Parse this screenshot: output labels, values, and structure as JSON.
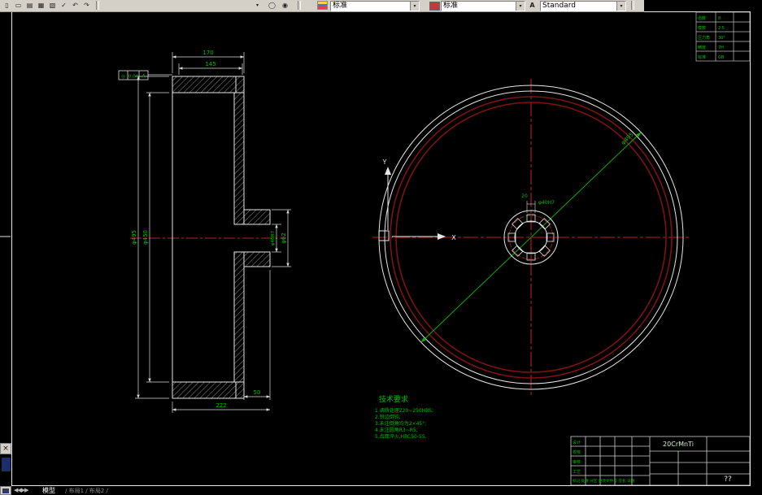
{
  "toolbar": {
    "menu_arrow": "▾",
    "icons": {
      "new": "▯",
      "open": "▭",
      "save": "▤",
      "print": "▦",
      "preview": "▧",
      "spell": "✓",
      "undo": "↶",
      "redo": "↷",
      "orbit1": "◯",
      "orbit2": "◉",
      "text_style": "A"
    },
    "combos": [
      {
        "name": "layer",
        "value": "标准"
      },
      {
        "name": "dimstyle",
        "value": "标准"
      },
      {
        "name": "textstyle",
        "value": "Standard"
      }
    ]
  },
  "drawing": {
    "ucs": {
      "x": "X",
      "y": "Y"
    },
    "left_view": {
      "dims": {
        "top": "170",
        "top2": "145",
        "od": "φ495",
        "id": "φ450",
        "hub_od": "φ62",
        "bore": "φ40H7",
        "hub_len": "50",
        "total_len": "222"
      },
      "gdt": {
        "sym": "◎",
        "tol": "0.04",
        "datum": "A"
      }
    },
    "front_view": {
      "dims": {
        "diameter": "φ495",
        "spline_w": "20",
        "spline_bore": "φ40H7"
      }
    },
    "tech_req": {
      "title": "技术要求",
      "lines": [
        "1.调质处理220~250HBS;",
        "2.锐边倒钝;",
        "3.未注倒角均为2×45°;",
        "4.未注圆角R3~R5;",
        "5.齿面淬火,HRC50-55."
      ]
    },
    "param_table": {
      "rows": [
        {
          "label": "齿数",
          "value": "8"
        },
        {
          "label": "模数",
          "value": "2.5"
        },
        {
          "label": "压力角",
          "value": "30°"
        },
        {
          "label": "精度",
          "value": "7H"
        },
        {
          "label": "标准",
          "value": "GB"
        }
      ]
    },
    "title_block": {
      "material": "20CrMnTi",
      "code": "??",
      "left_labels": [
        "设计",
        "校核",
        "审核",
        "工艺"
      ],
      "revision_row": "标记 处数 分区 更改文件号 签名 日期"
    }
  },
  "tabbar": {
    "nav": "◀◀▶▶",
    "model_tab": "模型",
    "layout_tabs": "/ 布局1 / 布局2 /"
  },
  "float_panel": {
    "close": "×"
  },
  "colors": {
    "dim_green": "#00bf00",
    "centerline_red": "#ff2a2a",
    "rim_maroon": "#7c1212"
  }
}
